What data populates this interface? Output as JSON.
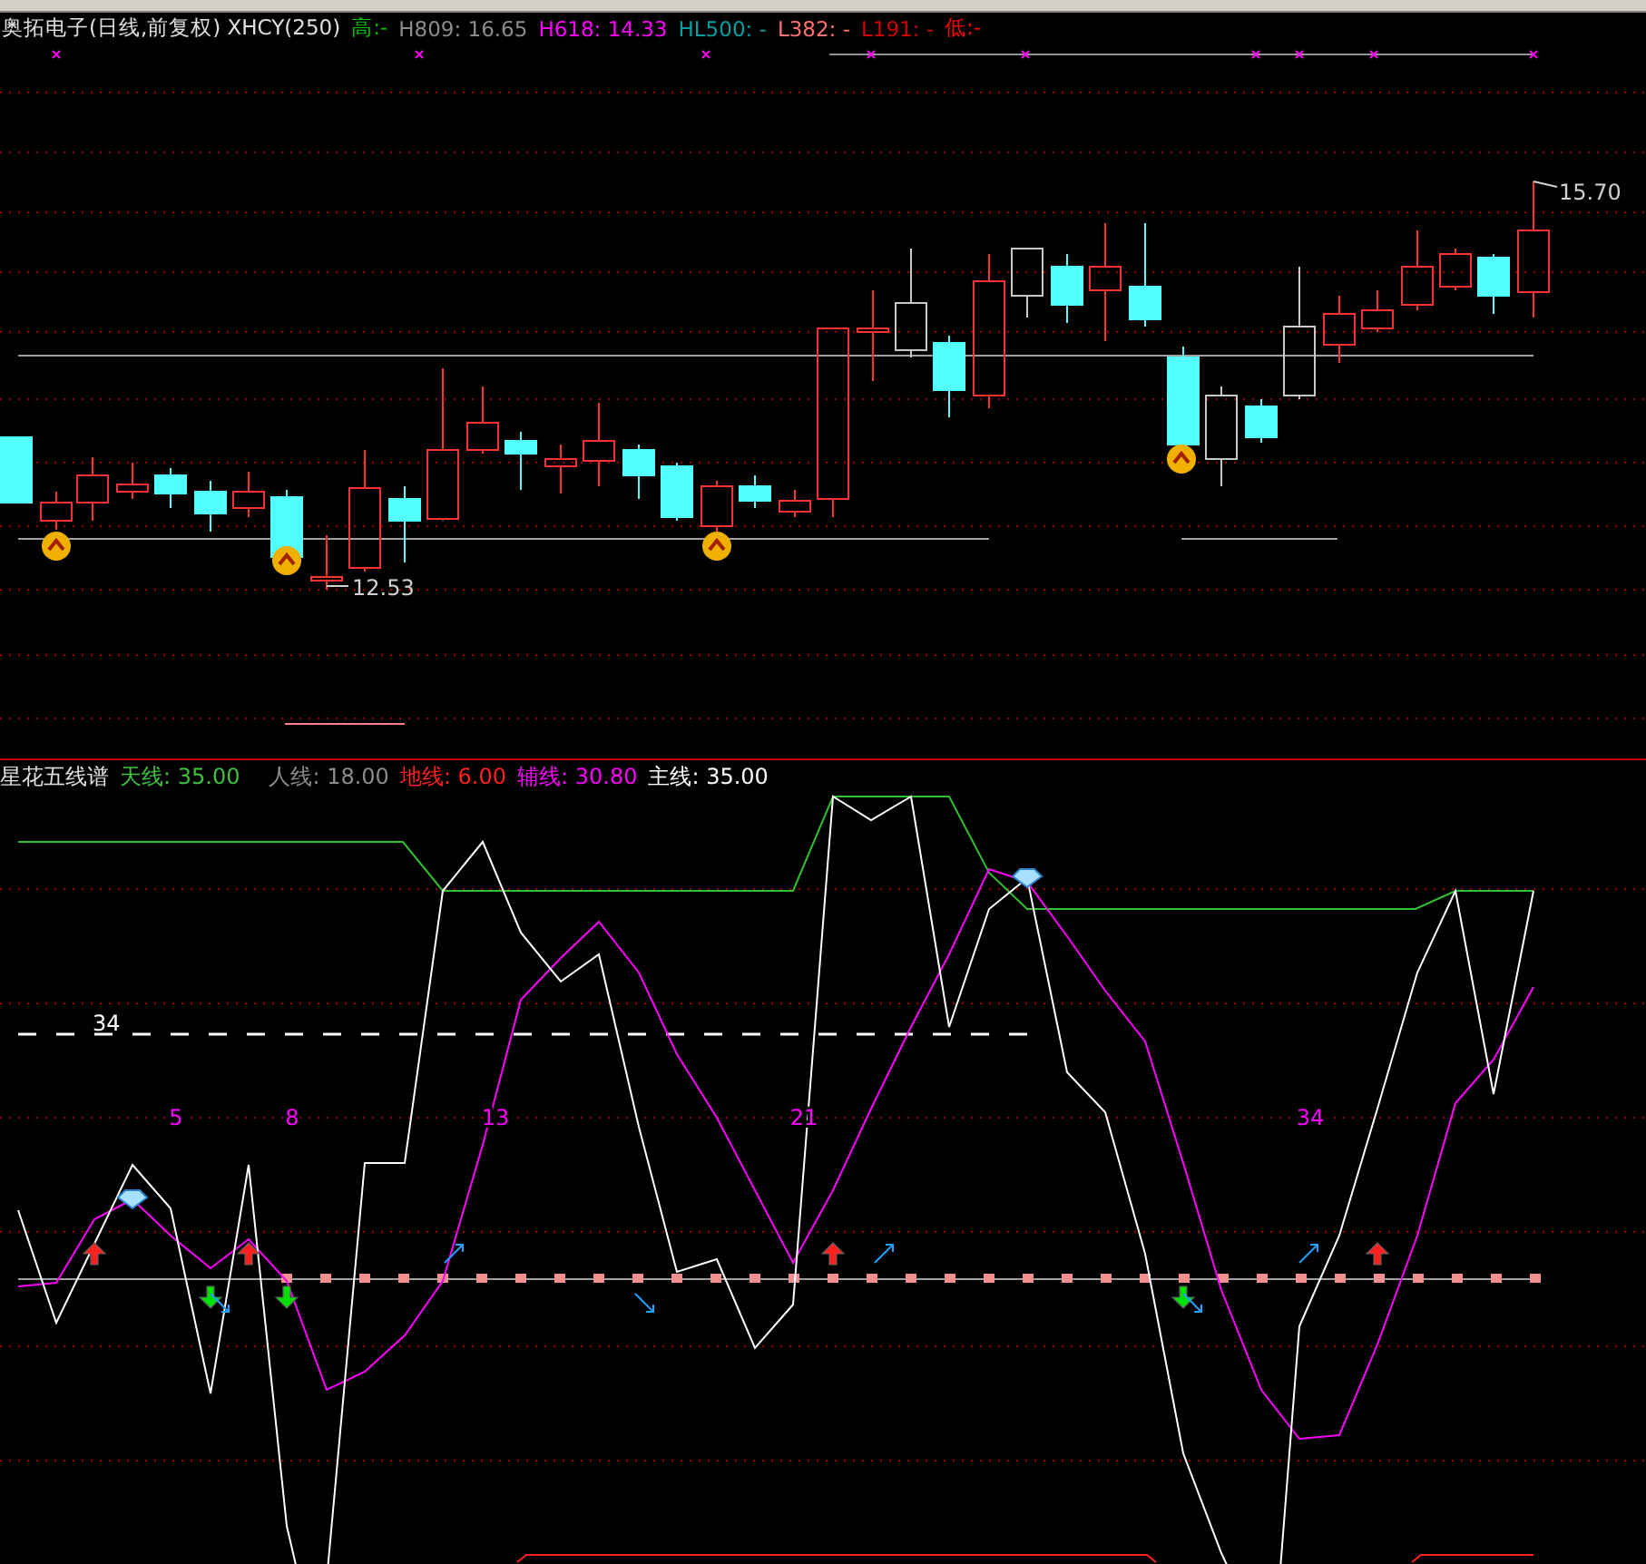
{
  "chart_header": {
    "title": "奥拓电子(日线,前复权) XHCY(250)",
    "items": [
      {
        "text": "高:-",
        "color": "#00c000"
      },
      {
        "text": "H809: 16.65",
        "color": "#8c8c8c"
      },
      {
        "text": "H618: 14.33",
        "color": "#ff00ff"
      },
      {
        "text": "HL500: -",
        "color": "#00a0a0"
      },
      {
        "text": "L382: -",
        "color": "#ff7070"
      },
      {
        "text": "L191: -",
        "color": "#d00000"
      },
      {
        "text": "低:-",
        "color": "#ff0000"
      }
    ]
  },
  "price_labels": [
    "15.70",
    "12.53"
  ],
  "indicator_header": {
    "title": "星花五线谱",
    "items": [
      {
        "text": "天线: 35.00",
        "color": "#40c040"
      },
      {
        "text": "人线: 18.00",
        "color": "#8c8c8c"
      },
      {
        "text": "地线: 6.00",
        "color": "#ff2020"
      },
      {
        "text": "辅线: 30.80",
        "color": "#ff00ff"
      },
      {
        "text": "主线: 35.00",
        "color": "#ffffff"
      }
    ]
  },
  "level_label": "34",
  "fib_numbers": [
    "5",
    "8",
    "13",
    "21",
    "34"
  ]
}
